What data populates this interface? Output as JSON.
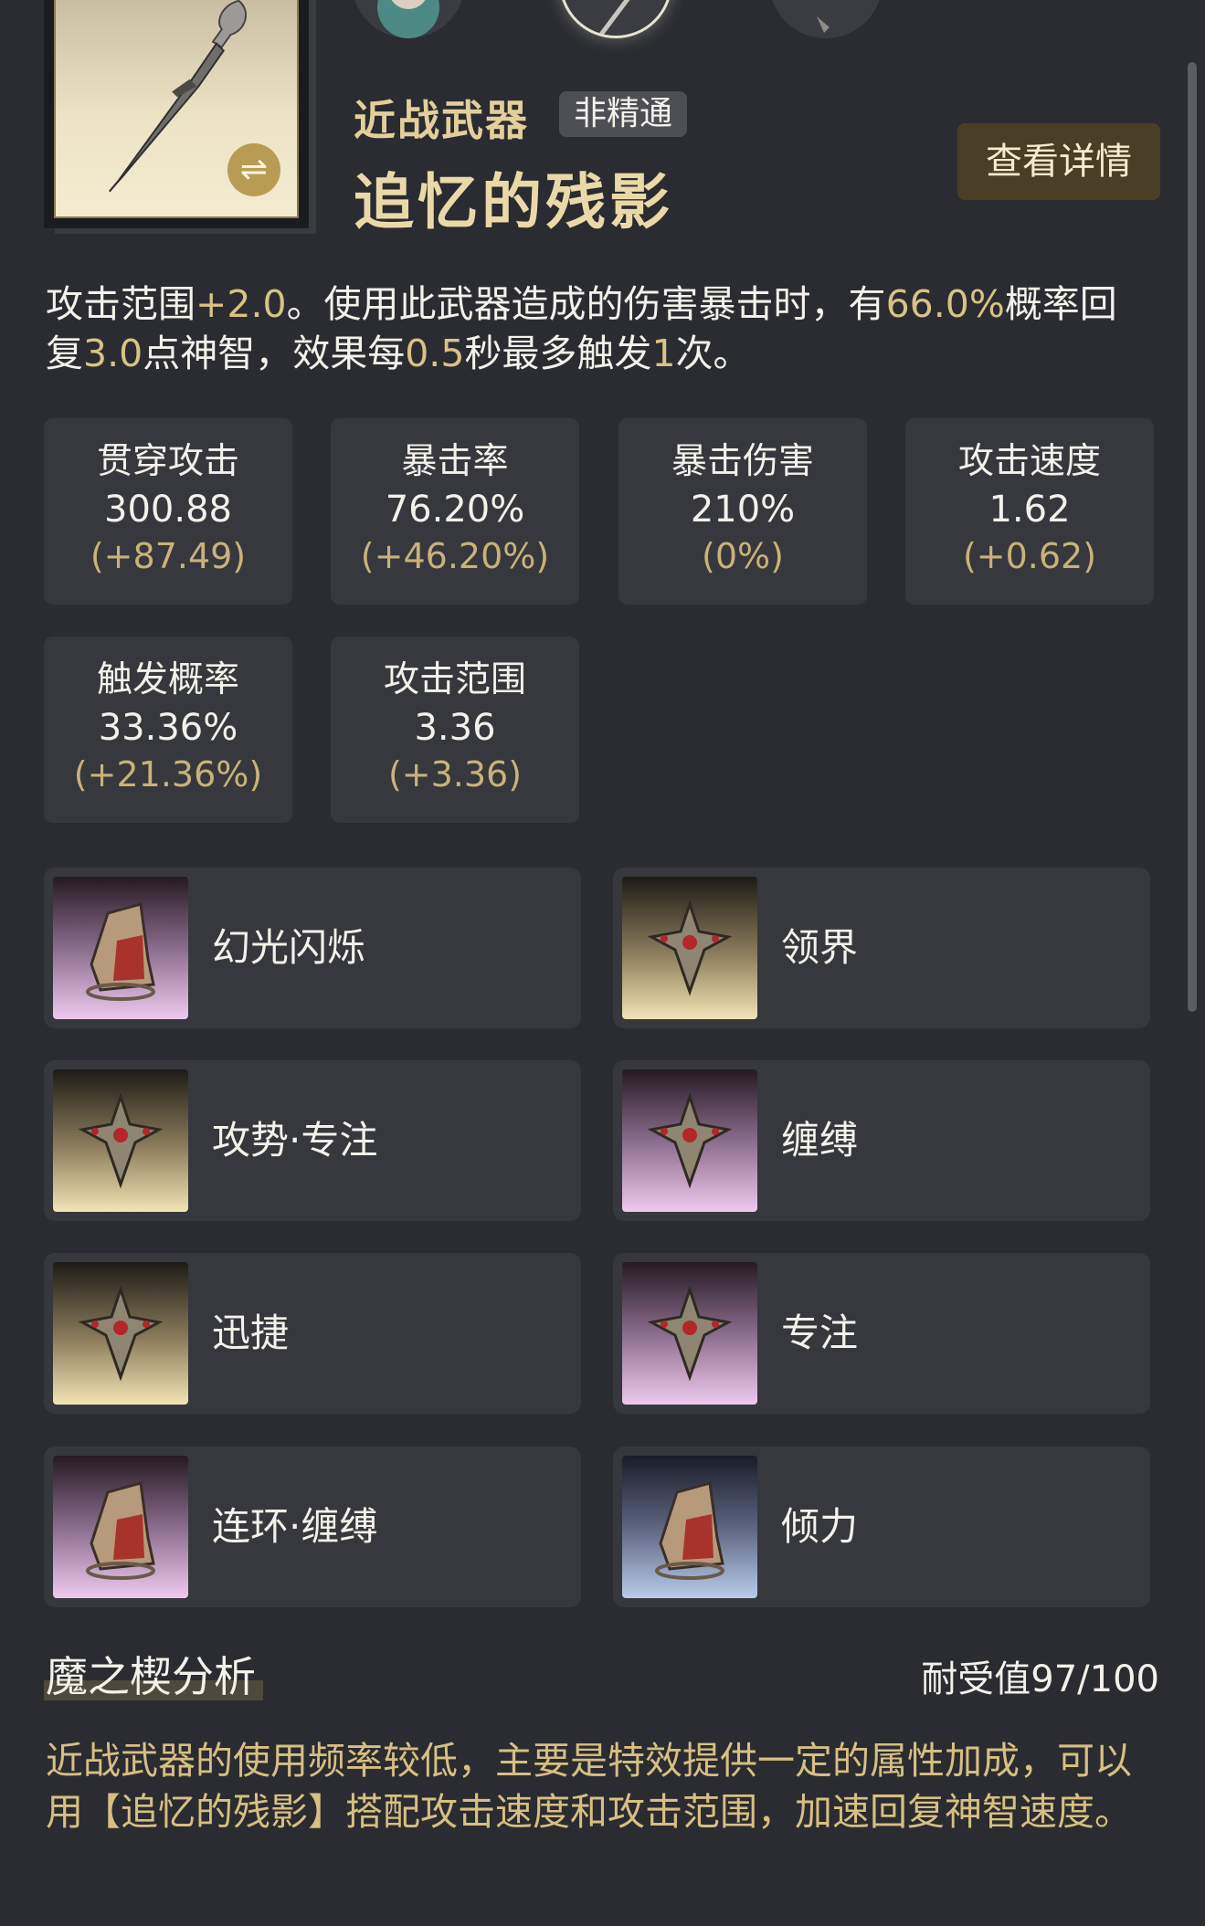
{
  "weapon": {
    "category": "近战武器",
    "badge": "非精通",
    "name": "追忆的残影",
    "detail_button": "查看详情",
    "swap_icon": "⇌"
  },
  "description": {
    "p1": "攻击范围",
    "v1": "+2.0",
    "p2": "。使用此武器造成的伤害暴击时，有",
    "v2": "66.0%",
    "p3": "概率回复",
    "v3": "3.0",
    "p4": "点神智，效果每",
    "v4": "0.5",
    "p5": "秒最多触发",
    "v5": "1",
    "p6": "次。"
  },
  "stats": [
    {
      "label": "贯穿攻击",
      "value": "300.88",
      "bonus": "(+87.49)"
    },
    {
      "label": "暴击率",
      "value": "76.20%",
      "bonus": "(+46.20%)"
    },
    {
      "label": "暴击伤害",
      "value": "210%",
      "bonus": "(0%)"
    },
    {
      "label": "攻击速度",
      "value": "1.62",
      "bonus": "(+0.62)"
    },
    {
      "label": "触发概率",
      "value": "33.36%",
      "bonus": "(+21.36%)"
    },
    {
      "label": "攻击范围",
      "value": "3.36",
      "bonus": "(+3.36)"
    }
  ],
  "skills": [
    {
      "name": "幻光闪烁",
      "icon": "helm-icon",
      "tint": "pink"
    },
    {
      "name": "领界",
      "icon": "crest-icon",
      "tint": "gold"
    },
    {
      "name": "攻势·专注",
      "icon": "crest-icon",
      "tint": "gold"
    },
    {
      "name": "缠缚",
      "icon": "crest-icon",
      "tint": "pink"
    },
    {
      "name": "迅捷",
      "icon": "crest-icon",
      "tint": "gold"
    },
    {
      "name": "专注",
      "icon": "crest-icon",
      "tint": "pink"
    },
    {
      "name": "连环·缠缚",
      "icon": "helm-icon",
      "tint": "pink"
    },
    {
      "name": "倾力",
      "icon": "helm-icon",
      "tint": "blue"
    }
  ],
  "analysis": {
    "title": "魔之楔分析",
    "durability": "耐受值97/100",
    "text": "近战武器的使用频率较低，主要是特效提供一定的属性加成，可以用【追忆的残影】搭配攻击速度和攻击范围，加速回复神智速度。"
  },
  "colors": {
    "background": "#2a2c31",
    "card": "#36383d",
    "gold_text": "#d9c286",
    "button": "#4a3f26"
  }
}
